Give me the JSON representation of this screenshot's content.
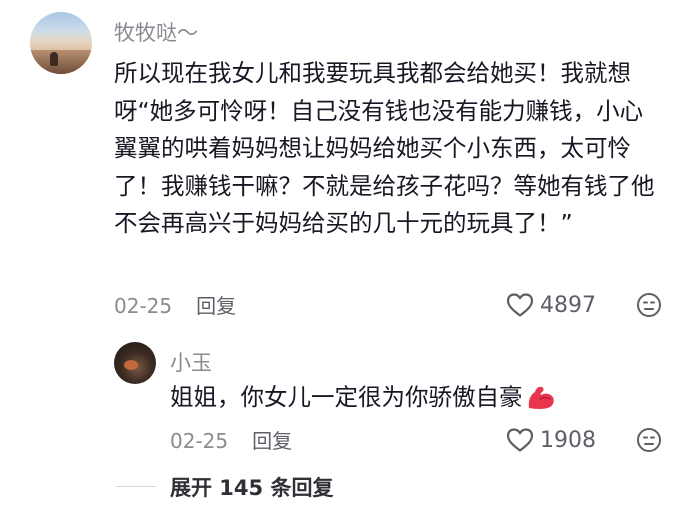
{
  "main_comment": {
    "username": "牧牧哒～",
    "text": "所以现在我女儿和我要玩具我都会给她买！我就想呀“她多可怜呀！自己没有钱也没有能力赚钱，小心翼翼的哄着妈妈想让妈妈给她买个小东西，太可怜了！我赚钱干嘛？不就是给孩子花吗？等她有钱了他不会再高兴于妈妈给买的几十元的玩具了！”",
    "date": "02-25",
    "reply_label": "回复",
    "like_count": "4897",
    "like_icon": "heart-outline-icon",
    "dislike_icon": "dislike-face-icon"
  },
  "reply_comment": {
    "username": "小玉",
    "text": "姐姐，你女儿一定很为你骄傲自豪",
    "emoji": "flexed-biceps-emoji",
    "date": "02-25",
    "reply_label": "回复",
    "like_count": "1908",
    "like_icon": "heart-outline-icon",
    "dislike_icon": "dislike-face-icon"
  },
  "expand": {
    "label": "展开 145 条回复"
  },
  "colors": {
    "text_primary": "#161823",
    "text_secondary": "#8a8b91",
    "icon": "#5d5f66",
    "emoji_red": "#e8364f"
  }
}
